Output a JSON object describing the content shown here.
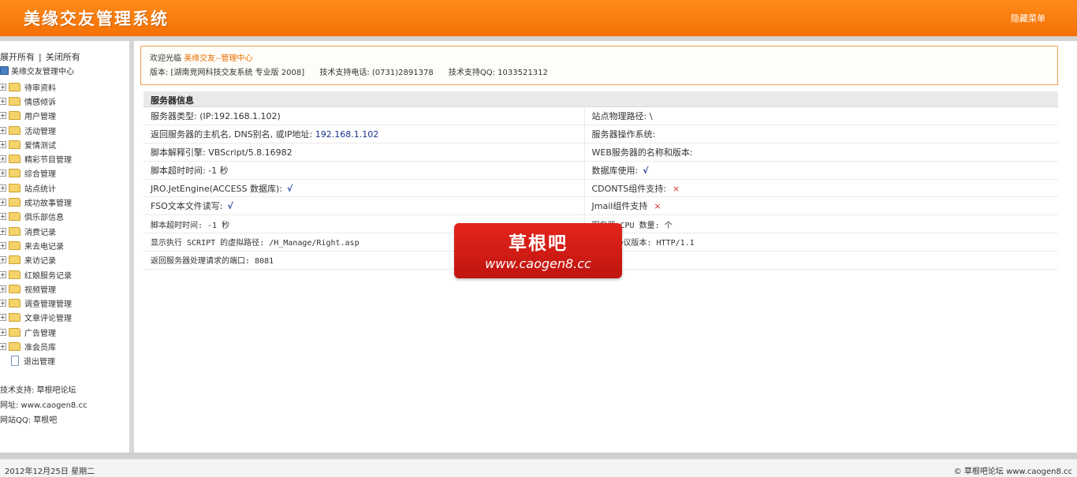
{
  "header": {
    "title": "美缘交友管理系统",
    "hide_menu": "隐藏菜单"
  },
  "sidebar": {
    "expand_all": "展开所有",
    "separator": "|",
    "collapse_all": "关闭所有",
    "root": "美缘交友管理中心",
    "items": [
      "待审资料",
      "情感倾诉",
      "用户管理",
      "活动管理",
      "爱情测试",
      "精彩节目管理",
      "综合管理",
      "站点统计",
      "成功故事管理",
      "俱乐部信息",
      "消费记录",
      "来去电记录",
      "来访记录",
      "红娘服务记录",
      "视频管理",
      "调查管理管理",
      "文章评论管理",
      "广告管理",
      "准会员库"
    ],
    "logout": "退出管理",
    "footer": {
      "support": "技术支持: 草根吧论坛",
      "website": "网址: www.caogen8.cc",
      "qq": "网站QQ: 草根吧"
    }
  },
  "welcome": {
    "prefix": "欢迎光临",
    "center": "美缘交友--管理中心",
    "version": "版本: [湖南竞网科技交友系统 专业版 2008]",
    "phone": "技术支持电话: (0731)2891378",
    "qq": "技术支持QQ: 1033521312"
  },
  "server": {
    "title": "服务器信息",
    "rows": [
      {
        "left": "服务器类型: (IP:192.168.1.102)",
        "right": "站点物理路径: \\"
      },
      {
        "left_label": "返回服务器的主机名, DNS别名, 或IP地址:",
        "left_value": "192.168.1.102",
        "right": "服务器操作系统:"
      },
      {
        "left": "脚本解释引擎: VBScript/5.8.16982",
        "right": "WEB服务器的名称和版本:"
      },
      {
        "left": "脚本超时时间: -1 秒",
        "right_label": "数据库使用:",
        "right_mark": "√"
      },
      {
        "left_label": "JRO.JetEngine(ACCESS 数据库):",
        "left_mark": "√",
        "right_label": "CDONTS组件支持:",
        "right_mark": "×"
      },
      {
        "left_label": "FSO文本文件读写:",
        "left_mark": "√",
        "right_label": "Jmail组件支持",
        "right_mark": "×"
      },
      {
        "left": "脚本超时时间: -1 秒",
        "right": "服务器 CPU 数量: 个"
      },
      {
        "left": "显示执行 SCRIPT 的虚拟路径: /H_Manage/Right.asp",
        "right": "服务器协议版本: HTTP/1.1"
      },
      {
        "left": "返回服务器处理请求的端口: 8081",
        "right": ""
      }
    ]
  },
  "footer": {
    "date": "2012年12月25日 星期二",
    "copyright": "© 草根吧论坛 www.caogen8.cc"
  },
  "watermark": {
    "name": "草根吧",
    "url": "www.caogen8.cc"
  }
}
